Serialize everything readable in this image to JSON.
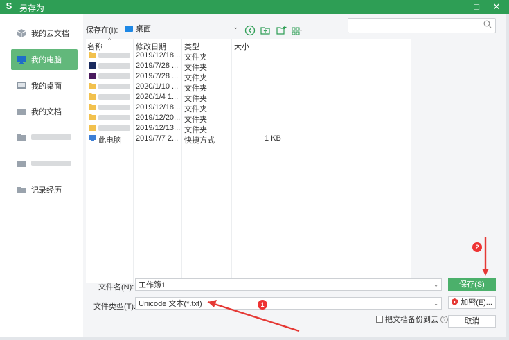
{
  "window": {
    "title": "另存为",
    "logo_glyph": "S",
    "maximize_glyph": "□",
    "close_glyph": "✕"
  },
  "sidebar": {
    "items": [
      {
        "label": "我的云文档",
        "icon": "cloud-cube-icon",
        "active": false
      },
      {
        "label": "我的电脑",
        "icon": "monitor-icon",
        "active": true
      },
      {
        "label": "我的桌面",
        "icon": "desktop-icon",
        "active": false
      },
      {
        "label": "我的文档",
        "icon": "folder-icon",
        "active": false
      },
      {
        "label": "",
        "icon": "folder-icon",
        "active": false
      },
      {
        "label": "",
        "icon": "folder-icon",
        "active": false
      },
      {
        "label": "记录经历",
        "icon": "folder-icon",
        "active": false
      }
    ]
  },
  "location": {
    "label": "保存在(I):",
    "value": "桌面"
  },
  "columns": {
    "name": "名称",
    "modified": "修改日期",
    "type": "类型",
    "size": "大小"
  },
  "files": [
    {
      "name": "",
      "date": "2019/12/18...",
      "type": "文件夹",
      "size": "",
      "icon": "folder-icon"
    },
    {
      "name": "",
      "date": "2019/7/28 ...",
      "type": "文件夹",
      "size": "",
      "icon": "app-icon"
    },
    {
      "name": "",
      "date": "2019/7/28 ...",
      "type": "文件夹",
      "size": "",
      "icon": "app-icon"
    },
    {
      "name": "",
      "date": "2020/1/10 ...",
      "type": "文件夹",
      "size": "",
      "icon": "folder-icon"
    },
    {
      "name": "",
      "date": "2020/1/4 1...",
      "type": "文件夹",
      "size": "",
      "icon": "folder-icon"
    },
    {
      "name": "",
      "date": "2019/12/18...",
      "type": "文件夹",
      "size": "",
      "icon": "folder-icon"
    },
    {
      "name": "",
      "date": "2019/12/20...",
      "type": "文件夹",
      "size": "",
      "icon": "folder-icon"
    },
    {
      "name": "",
      "date": "2019/12/13...",
      "type": "文件夹",
      "size": "",
      "icon": "folder-icon"
    },
    {
      "name": "此电脑",
      "date": "2019/7/7 2...",
      "type": "快捷方式",
      "size": "1 KB",
      "icon": "computer-shortcut-icon"
    }
  ],
  "form": {
    "filename_label": "文件名(N):",
    "filename_value": "工作簿1",
    "filetype_label": "文件类型(T):",
    "filetype_value": "Unicode 文本(*.txt)",
    "backup_label": "把文档备份到云"
  },
  "buttons": {
    "save": "保存(S)",
    "encrypt": "加密(E)...",
    "cancel": "取消"
  },
  "annotations": {
    "badge1": "1",
    "badge2": "2"
  },
  "colors": {
    "accent": "#2e9e55",
    "active_item": "#62b87b",
    "arrow": "#e53935"
  }
}
